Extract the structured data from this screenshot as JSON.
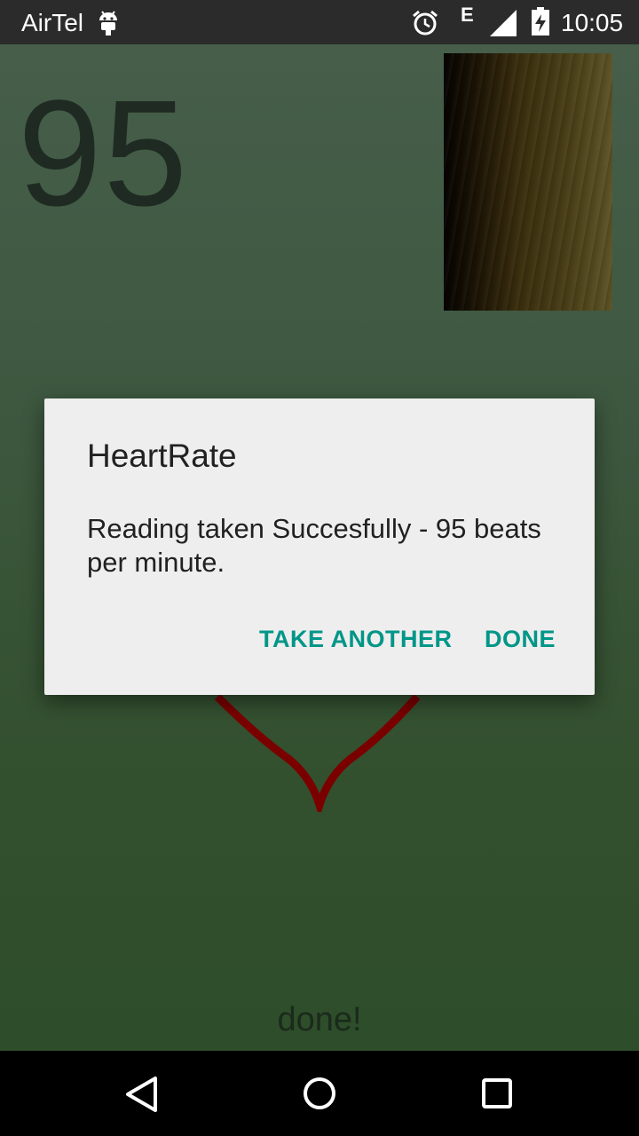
{
  "status_bar": {
    "carrier": "AirTel",
    "network_type": "E",
    "time": "10:05",
    "icons": [
      "android-icon",
      "alarm-icon",
      "signal-icon",
      "battery-charging-icon"
    ]
  },
  "app": {
    "bpm": "95",
    "status_text": "done!"
  },
  "dialog": {
    "title": "HeartRate",
    "message": "Reading taken Succesfully - 95 beats per minute.",
    "buttons": {
      "take_another": "TAKE ANOTHER",
      "done": "DONE"
    },
    "button_color": "#009688"
  },
  "nav_bar": {
    "icons": [
      "back-icon",
      "home-icon",
      "recents-icon"
    ]
  },
  "colors": {
    "heart_stroke": "#7a0000",
    "app_background": "#3f5942"
  }
}
